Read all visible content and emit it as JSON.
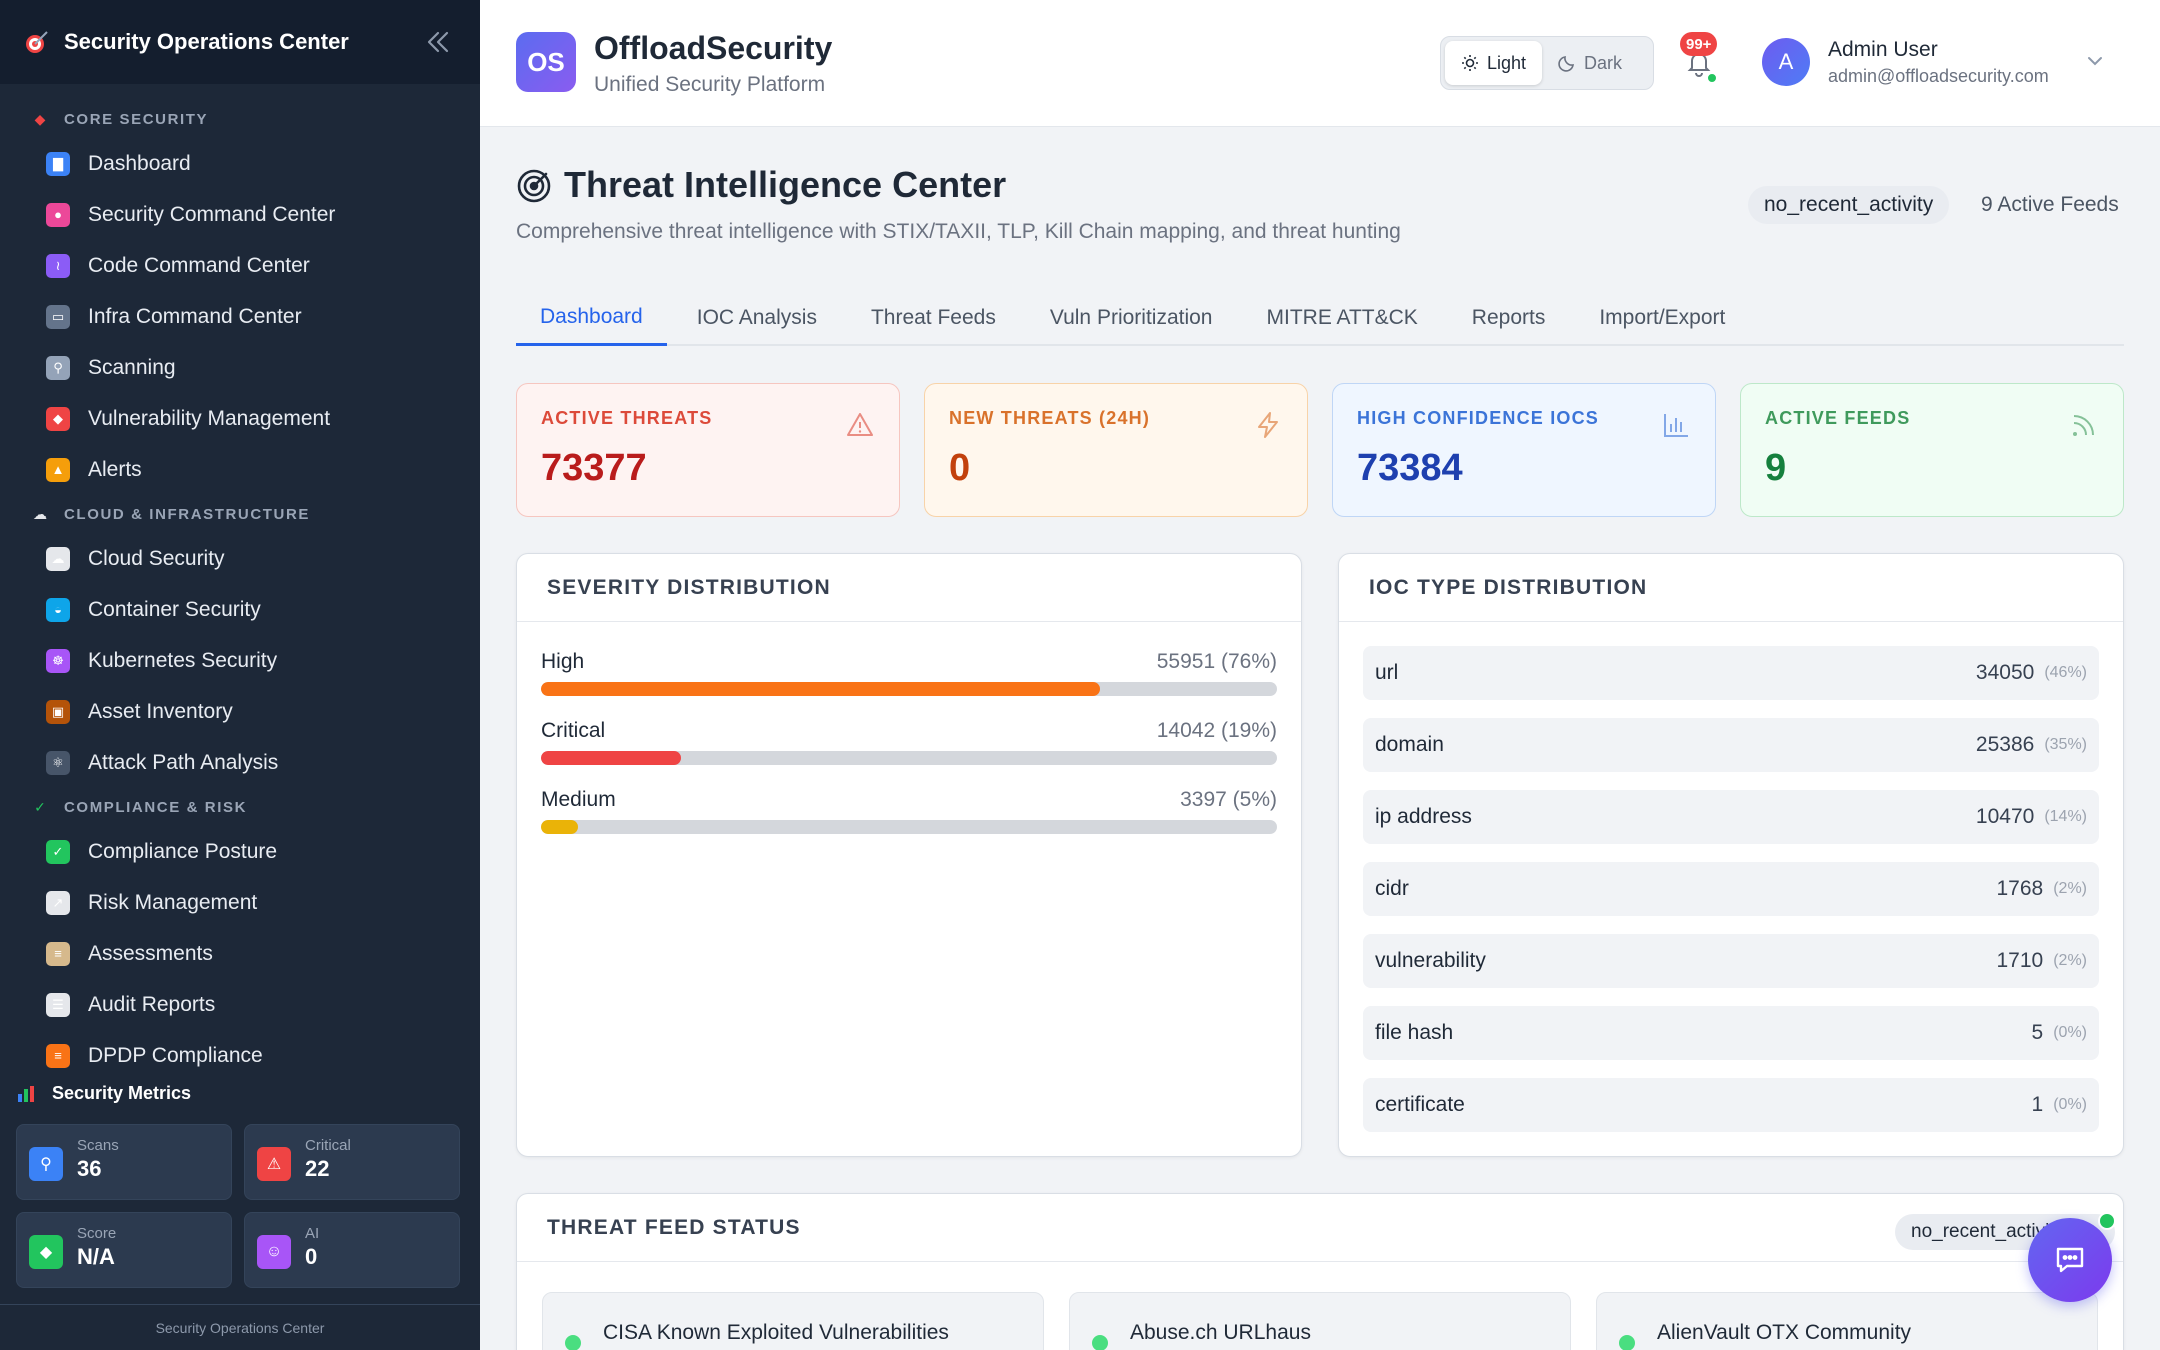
{
  "sidebar": {
    "title": "Security Operations Center",
    "sections": [
      {
        "label": "CORE SECURITY",
        "icon": "shield-icon",
        "items": [
          {
            "label": "Dashboard",
            "icon": "bar-chart-icon",
            "color": "#3b82f6"
          },
          {
            "label": "Security Command Center",
            "icon": "brain-icon",
            "color": "#ec4899"
          },
          {
            "label": "Code Command Center",
            "icon": "dna-icon",
            "color": "#8b5cf6"
          },
          {
            "label": "Infra Command Center",
            "icon": "monitor-icon",
            "color": "#64748b"
          },
          {
            "label": "Scanning",
            "icon": "magnifier-icon",
            "color": "#94a3b8"
          },
          {
            "label": "Vulnerability Management",
            "icon": "shield-icon",
            "color": "#ef4444"
          },
          {
            "label": "Alerts",
            "icon": "bell-icon",
            "color": "#f59e0b"
          }
        ]
      },
      {
        "label": "CLOUD & INFRASTRUCTURE",
        "icon": "cloud-icon",
        "items": [
          {
            "label": "Cloud Security",
            "icon": "cloud-icon",
            "color": "#e5e7eb"
          },
          {
            "label": "Container Security",
            "icon": "whale-icon",
            "color": "#0ea5e9"
          },
          {
            "label": "Kubernetes Security",
            "icon": "helm-icon",
            "color": "#a855f7"
          },
          {
            "label": "Asset Inventory",
            "icon": "box-icon",
            "color": "#b45309"
          },
          {
            "label": "Attack Path Analysis",
            "icon": "atom-icon",
            "color": "#475569"
          }
        ]
      },
      {
        "label": "COMPLIANCE & RISK",
        "icon": "check-icon",
        "items": [
          {
            "label": "Compliance Posture",
            "icon": "check-icon",
            "color": "#22c55e"
          },
          {
            "label": "Risk Management",
            "icon": "trend-chart-icon",
            "color": "#e5e7eb"
          },
          {
            "label": "Assessments",
            "icon": "clipboard-icon",
            "color": "#d6b98c"
          },
          {
            "label": "Audit Reports",
            "icon": "document-icon",
            "color": "#e5e7eb"
          },
          {
            "label": "DPDP Compliance",
            "icon": "india-flag-icon",
            "color": "#f97316"
          }
        ]
      }
    ],
    "metrics_title": "Security Metrics",
    "metrics": [
      {
        "label": "Scans",
        "value": "36",
        "icon": "magnifier-icon",
        "color": "#3b82f6"
      },
      {
        "label": "Critical",
        "value": "22",
        "icon": "warning-icon",
        "color": "#ef4444"
      },
      {
        "label": "Score",
        "value": "N/A",
        "icon": "shield-icon",
        "color": "#22c55e"
      },
      {
        "label": "AI",
        "value": "0",
        "icon": "robot-icon",
        "color": "#a855f7"
      }
    ],
    "footer": "Security Operations Center"
  },
  "header": {
    "badge": "OS",
    "brand": "OffloadSecurity",
    "subtitle": "Unified Security Platform",
    "theme_light": "Light",
    "theme_dark": "Dark",
    "notif_count": "99+",
    "user_initial": "A",
    "user_name": "Admin User",
    "user_email": "admin@offloadsecurity.com"
  },
  "page": {
    "title": "Threat Intelligence Center",
    "subtitle": "Comprehensive threat intelligence with STIX/TAXII, TLP, Kill Chain mapping, and threat hunting",
    "status": "no_recent_activity",
    "feeds_count": "9 Active Feeds",
    "tabs": [
      "Dashboard",
      "IOC Analysis",
      "Threat Feeds",
      "Vuln Prioritization",
      "MITRE ATT&CK",
      "Reports",
      "Import/Export"
    ],
    "active_tab": 0
  },
  "stats": [
    {
      "label": "ACTIVE THREATS",
      "value": "73377",
      "icon": "warning-icon",
      "label_color": "#dc4a3a",
      "value_color": "#b91c1c",
      "bg": "#fef3f2",
      "border": "#f6c6c0"
    },
    {
      "label": "NEW THREATS (24H)",
      "value": "0",
      "icon": "lightning-icon",
      "label_color": "#d9722b",
      "value_color": "#c2410c",
      "bg": "#fff7ed",
      "border": "#f8d3a8"
    },
    {
      "label": "HIGH CONFIDENCE IOCS",
      "value": "73384",
      "icon": "bar-chart-icon",
      "label_color": "#3b74d8",
      "value_color": "#1e40af",
      "bg": "#eff6ff",
      "border": "#bfd6f6"
    },
    {
      "label": "ACTIVE FEEDS",
      "value": "9",
      "icon": "rss-icon",
      "label_color": "#3f9a5c",
      "value_color": "#15803d",
      "bg": "#f0fdf4",
      "border": "#bde8c9"
    }
  ],
  "severity": {
    "title": "SEVERITY DISTRIBUTION",
    "rows": [
      {
        "name": "High",
        "count": "55951 (76%)",
        "fraction": 0.76,
        "color": "#f97316"
      },
      {
        "name": "Critical",
        "count": "14042 (19%)",
        "fraction": 0.19,
        "color": "#ef4444"
      },
      {
        "name": "Medium",
        "count": "3397 (5%)",
        "fraction": 0.05,
        "color": "#eab308"
      }
    ]
  },
  "ioc": {
    "title": "IOC TYPE DISTRIBUTION",
    "rows": [
      {
        "name": "url",
        "count": "34050",
        "pct": "(46%)"
      },
      {
        "name": "domain",
        "count": "25386",
        "pct": "(35%)"
      },
      {
        "name": "ip address",
        "count": "10470",
        "pct": "(14%)"
      },
      {
        "name": "cidr",
        "count": "1768",
        "pct": "(2%)"
      },
      {
        "name": "vulnerability",
        "count": "1710",
        "pct": "(2%)"
      },
      {
        "name": "file hash",
        "count": "5",
        "pct": "(0%)"
      },
      {
        "name": "certificate",
        "count": "1",
        "pct": "(0%)"
      }
    ]
  },
  "feed_status": {
    "title": "THREAT FEED STATUS",
    "status": "no_recent_activity",
    "feeds": [
      "CISA Known Exploited Vulnerabilities",
      "Abuse.ch URLhaus",
      "AlienVault OTX Community"
    ]
  }
}
